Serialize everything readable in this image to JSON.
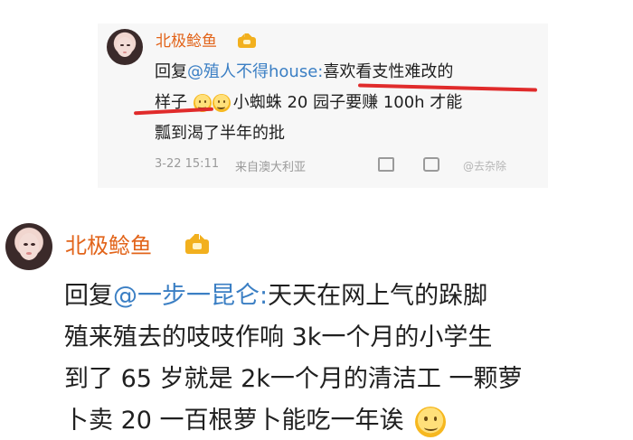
{
  "reply1": {
    "username": "北极鲶鱼",
    "line1_prefix": "回复",
    "mention": "@殖人不得house:",
    "line1_highlight": "喜欢看支性难改的",
    "line2_highlight": "样子",
    "line2_rest": "小蜘蛛 20 园子要赚 100h 才能",
    "line3": "瓢到渴了半年的批",
    "timestamp": "3-22 15:11",
    "source": "来自澳大利亚",
    "watermark": "@去杂除"
  },
  "reply2": {
    "username": "北极鲶鱼",
    "line1_prefix": "回复",
    "mention": "@一步一昆仑:",
    "line1_rest": "天天在网上气的跺脚",
    "line2": "殖来殖去的吱吱作响 3k一个月的小学生",
    "line3": "到了 65 岁就是 2k一个月的清洁工 一颗萝",
    "line4": "卜卖 20 一百根萝卜能吃一年诶"
  },
  "colors": {
    "username": "#e2641a",
    "mention": "#3b7fc4",
    "underline": "#e02b2b",
    "meta": "#9a9a9a"
  }
}
